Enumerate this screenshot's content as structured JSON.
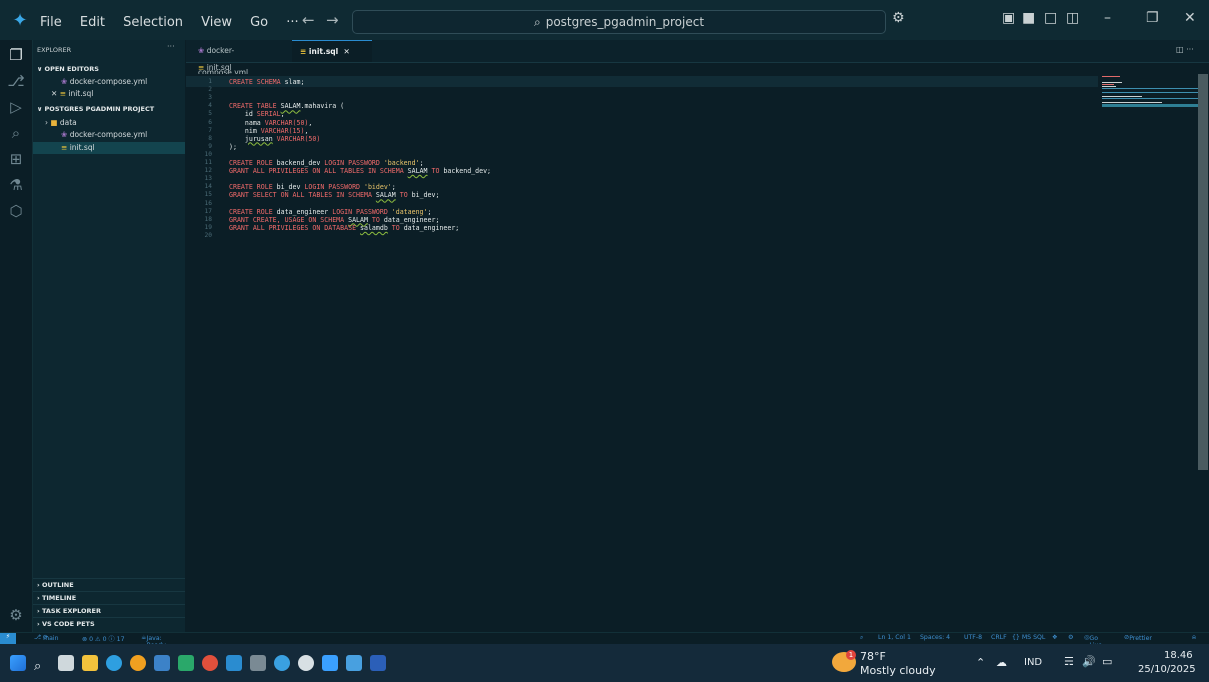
{
  "titlebar": {
    "menu": [
      "File",
      "Edit",
      "Selection",
      "View",
      "Go",
      "···"
    ],
    "search_text": "postgres_pgadmin_project"
  },
  "sidebar": {
    "explorer_title": "EXPLORER",
    "open_editors_title": "OPEN EDITORS",
    "open_editors": [
      "docker-compose.yml",
      "init.sql"
    ],
    "project_title": "POSTGRES PGADMIN PROJECT",
    "project_items": [
      "data",
      "docker-compose.yml",
      "init.sql"
    ],
    "bottom_sections": [
      "OUTLINE",
      "TIMELINE",
      "TASK EXPLORER",
      "VS CODE PETS"
    ]
  },
  "tabs": [
    {
      "label": "docker-compose.yml",
      "active": false
    },
    {
      "label": "init.sql",
      "active": true
    }
  ],
  "breadcrumb": "init.sql",
  "code_lines": [
    {
      "n": "1",
      "parts": [
        [
          "kw",
          "CREATE SCHEMA "
        ],
        [
          "",
          "slam;"
        ]
      ]
    },
    {
      "n": "2",
      "parts": []
    },
    {
      "n": "3",
      "parts": []
    },
    {
      "n": "4",
      "parts": [
        [
          "kw",
          "CREATE TABLE "
        ],
        [
          "sq",
          "SALAM"
        ],
        [
          "",
          ".mahavira ("
        ]
      ]
    },
    {
      "n": "5",
      "parts": [
        [
          "",
          "    id "
        ],
        [
          "kw",
          "SERIAL"
        ],
        [
          "",
          ","
        ]
      ]
    },
    {
      "n": "6",
      "parts": [
        [
          "",
          "    nama "
        ],
        [
          "kw",
          "VARCHAR(50)"
        ],
        [
          "",
          ","
        ]
      ]
    },
    {
      "n": "7",
      "parts": [
        [
          "",
          "    nim "
        ],
        [
          "kw",
          "VARCHAR(15)"
        ],
        [
          "",
          ","
        ]
      ]
    },
    {
      "n": "8",
      "parts": [
        [
          "",
          "    "
        ],
        [
          "sq",
          "jurusan"
        ],
        [
          "kw",
          " VARCHAR(50)"
        ]
      ]
    },
    {
      "n": "9",
      "parts": [
        [
          "",
          ");"
        ]
      ]
    },
    {
      "n": "10",
      "parts": []
    },
    {
      "n": "11",
      "parts": [
        [
          "kw",
          "CREATE ROLE "
        ],
        [
          "",
          "backend_dev "
        ],
        [
          "kw",
          "LOGIN PASSWORD "
        ],
        [
          "str",
          "'backend'"
        ],
        [
          "",
          ";"
        ]
      ]
    },
    {
      "n": "12",
      "parts": [
        [
          "kw",
          "GRANT ALL PRIVILEGES ON ALL TABLES IN SCHEMA "
        ],
        [
          "sq",
          "SALAM"
        ],
        [
          "kw",
          " TO "
        ],
        [
          "",
          "backend_dev;"
        ]
      ]
    },
    {
      "n": "13",
      "parts": []
    },
    {
      "n": "14",
      "parts": [
        [
          "kw",
          "CREATE ROLE "
        ],
        [
          "",
          "bi_dev "
        ],
        [
          "kw",
          "LOGIN PASSWORD "
        ],
        [
          "str",
          "'bidev'"
        ],
        [
          "",
          ";"
        ]
      ]
    },
    {
      "n": "15",
      "parts": [
        [
          "kw",
          "GRANT SELECT ON ALL TABLES IN SCHEMA "
        ],
        [
          "sq",
          "SALAM"
        ],
        [
          "kw",
          " TO "
        ],
        [
          "",
          "bi_dev;"
        ]
      ]
    },
    {
      "n": "16",
      "parts": []
    },
    {
      "n": "17",
      "parts": [
        [
          "kw",
          "CREATE ROLE "
        ],
        [
          "",
          "data_engineer "
        ],
        [
          "kw",
          "LOGIN PASSWORD "
        ],
        [
          "str",
          "'dataeng'"
        ],
        [
          "",
          ";"
        ]
      ]
    },
    {
      "n": "18",
      "parts": [
        [
          "kw",
          "GRANT CREATE, USAGE ON SCHEMA "
        ],
        [
          "sq",
          "SALAM"
        ],
        [
          "kw",
          " TO "
        ],
        [
          "",
          "data_engineer;"
        ]
      ]
    },
    {
      "n": "19",
      "parts": [
        [
          "kw",
          "GRANT ALL PRIVILEGES ON DATABASE "
        ],
        [
          "sq",
          "salamdb"
        ],
        [
          "kw",
          " TO "
        ],
        [
          "",
          "data_engineer;"
        ]
      ]
    },
    {
      "n": "20",
      "parts": []
    }
  ],
  "status": {
    "branch": "main",
    "problems": "⊗ 0 ⚠ 0 ⓘ 17",
    "java": "Java: Ready",
    "position": "Ln 1, Col 1",
    "spaces": "Spaces: 4",
    "encoding": "UTF-8",
    "eol": "CRLF",
    "language": "{} MS SQL",
    "golive": "Go Live",
    "prettier": "Prettier"
  },
  "taskbar": {
    "weather_temp": "78°F",
    "weather_desc": "Mostly cloudy",
    "weather_badge": "1",
    "lang": "IND",
    "time": "18.46",
    "date": "25/10/2025"
  },
  "colors": {
    "accent": "#2a8cd0",
    "keyword": "#f06a6a",
    "string": "#e9c46a"
  }
}
